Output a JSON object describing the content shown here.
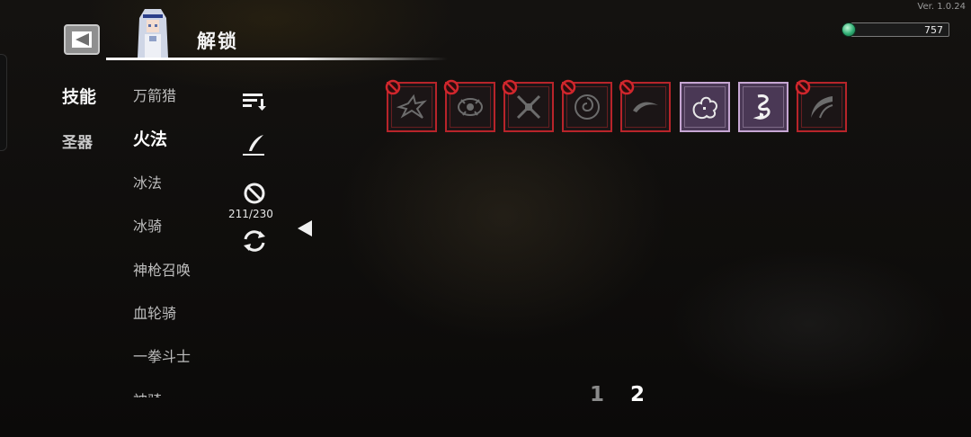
{
  "version": "Ver. 1.0.24",
  "currency": {
    "icon": "gem-icon",
    "amount": "757"
  },
  "header": {
    "title": "解锁"
  },
  "categories": [
    {
      "label": "技能",
      "active": true
    },
    {
      "label": "圣器",
      "active": false
    }
  ],
  "skills": [
    {
      "label": "万箭猎"
    },
    {
      "label": "火法",
      "active": true
    },
    {
      "label": "冰法"
    },
    {
      "label": "冰骑"
    },
    {
      "label": "神枪召唤"
    },
    {
      "label": "血轮骑"
    },
    {
      "label": "一拳斗士"
    },
    {
      "label": "神骑"
    }
  ],
  "tools": {
    "sort_icon": "sort-icon",
    "edit_icon": "quill-icon",
    "ban_icon": "ban-icon",
    "ban_count": "211/230",
    "refresh_icon": "refresh-icon"
  },
  "slots": [
    {
      "icon": "spiked-dragon-icon",
      "banned": true
    },
    {
      "icon": "flame-eye-icon",
      "banned": true
    },
    {
      "icon": "crossed-swords-icon",
      "banned": true
    },
    {
      "icon": "vortex-orb-icon",
      "banned": true
    },
    {
      "icon": "wave-slash-icon",
      "banned": true
    },
    {
      "icon": "explosion-icon",
      "banned": false
    },
    {
      "icon": "tornado-icon",
      "banned": false
    },
    {
      "icon": "claw-slash-icon",
      "banned": true
    }
  ],
  "pagination": {
    "pages": [
      "1",
      "2"
    ],
    "current": "2"
  },
  "colors": {
    "ban_red": "#b8242a",
    "owned_purple": "#4a3855",
    "gem_green": "#2fae74"
  }
}
